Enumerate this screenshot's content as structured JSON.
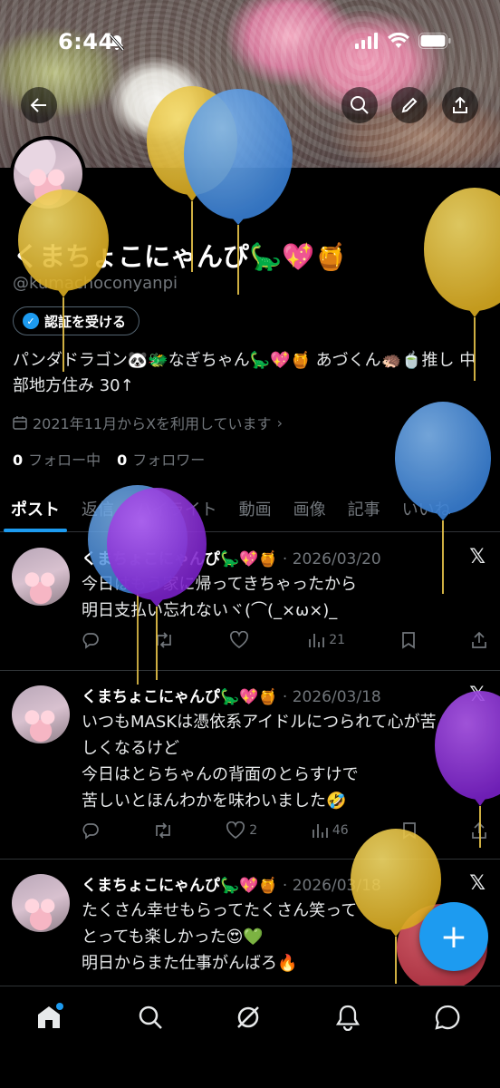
{
  "status_bar": {
    "time": "6:44"
  },
  "profile": {
    "display_name": "くまちょこにゃんぴ🦕💖🍯",
    "handle": "@kumachoconyanpi",
    "verify_button": "認証を受ける",
    "bio": "パンダドラゴン🐼🐲なぎちゃん🦕💖🍯 あづくん🦔🍵推し 中部地方住み 30↑",
    "joined": "2021年11月からXを利用しています",
    "following_count": "0",
    "following_label": "フォロー中",
    "followers_count": "0",
    "followers_label": "フォロワー"
  },
  "tabs": [
    "ポスト",
    "返信",
    "ハイライト",
    "動画",
    "画像",
    "記事",
    "いいね"
  ],
  "posts": [
    {
      "name": "くまちょこにゃんぴ🦕💖🍯",
      "date": "2026/03/20",
      "lines": [
        "今日はもう家に帰ってきちゃったから",
        "明日支払い忘れないヾ(⌒(_×ω×)_"
      ],
      "likes": "",
      "views": "21"
    },
    {
      "name": "くまちょこにゃんぴ🦕💖🍯",
      "date": "2026/03/18",
      "lines": [
        "いつもMASKは憑依系アイドルにつられて心が苦",
        "しくなるけど",
        "今日はとらちゃんの背面のとらすけで",
        "苦しいとほんわかを味わいました🤣"
      ],
      "likes": "2",
      "views": "46"
    },
    {
      "name": "くまちょこにゃんぴ🦕💖🍯",
      "date": "2026/03/18",
      "lines": [
        "たくさん幸せもらってたくさん笑って",
        "とっても楽しかった😍💚",
        "明日からまた仕事がんばろ🔥"
      ]
    }
  ],
  "fab_label": "+",
  "colors": {
    "accent": "#1d9bf0",
    "background": "#000000",
    "muted": "#71767b",
    "balloon_yellow": "#e8c13a",
    "balloon_blue": "#4a94e0",
    "balloon_purple": "#8a2fd6"
  }
}
